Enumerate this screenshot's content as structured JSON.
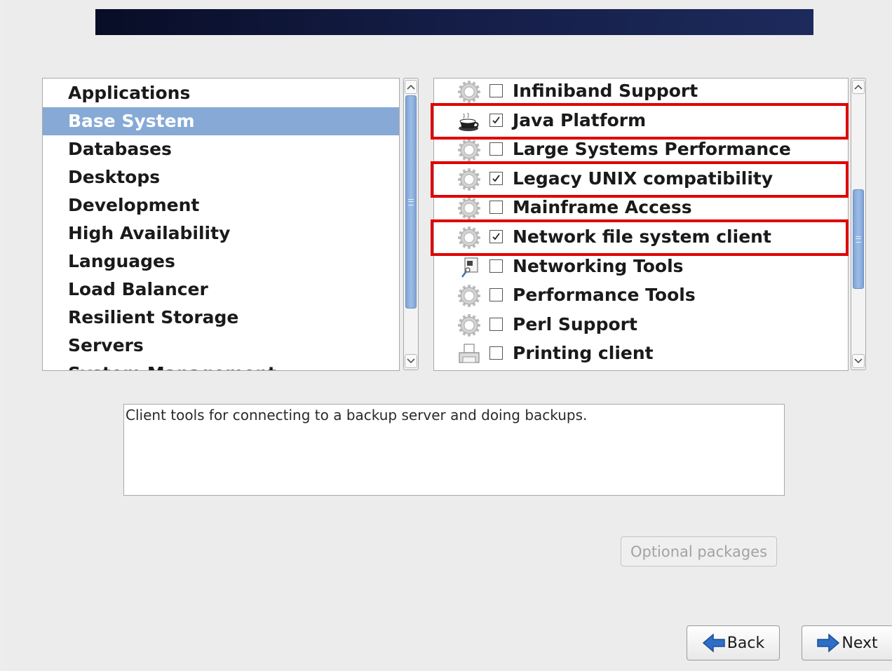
{
  "categories": [
    {
      "label": "Applications",
      "selected": false
    },
    {
      "label": "Base System",
      "selected": true
    },
    {
      "label": "Databases",
      "selected": false
    },
    {
      "label": "Desktops",
      "selected": false
    },
    {
      "label": "Development",
      "selected": false
    },
    {
      "label": "High Availability",
      "selected": false
    },
    {
      "label": "Languages",
      "selected": false
    },
    {
      "label": "Load Balancer",
      "selected": false
    },
    {
      "label": "Resilient Storage",
      "selected": false
    },
    {
      "label": "Servers",
      "selected": false
    },
    {
      "label": "System Management",
      "selected": false
    }
  ],
  "packages": [
    {
      "label": "Infiniband Support",
      "checked": false,
      "icon": "gear-icon",
      "highlighted": false
    },
    {
      "label": "Java Platform",
      "checked": true,
      "icon": "java-cup-icon",
      "highlighted": true
    },
    {
      "label": "Large Systems Performance",
      "checked": false,
      "icon": "gear-icon",
      "highlighted": false
    },
    {
      "label": "Legacy UNIX compatibility",
      "checked": true,
      "icon": "gear-icon",
      "highlighted": true
    },
    {
      "label": "Mainframe Access",
      "checked": false,
      "icon": "gear-icon",
      "highlighted": false
    },
    {
      "label": "Network file system client",
      "checked": true,
      "icon": "gear-icon",
      "highlighted": true
    },
    {
      "label": "Networking Tools",
      "checked": false,
      "icon": "network-tools-icon",
      "highlighted": false
    },
    {
      "label": "Performance Tools",
      "checked": false,
      "icon": "gear-icon",
      "highlighted": false
    },
    {
      "label": "Perl Support",
      "checked": false,
      "icon": "gear-icon",
      "highlighted": false
    },
    {
      "label": "Printing client",
      "checked": false,
      "icon": "printer-icon",
      "highlighted": false
    }
  ],
  "description": "Client tools for connecting to a backup server and doing backups.",
  "buttons": {
    "optional_packages": "Optional packages",
    "back": "Back",
    "next": "Next"
  },
  "colors": {
    "highlight": "#e00000",
    "selection": "#86a9d6",
    "banner": "#131c44"
  }
}
